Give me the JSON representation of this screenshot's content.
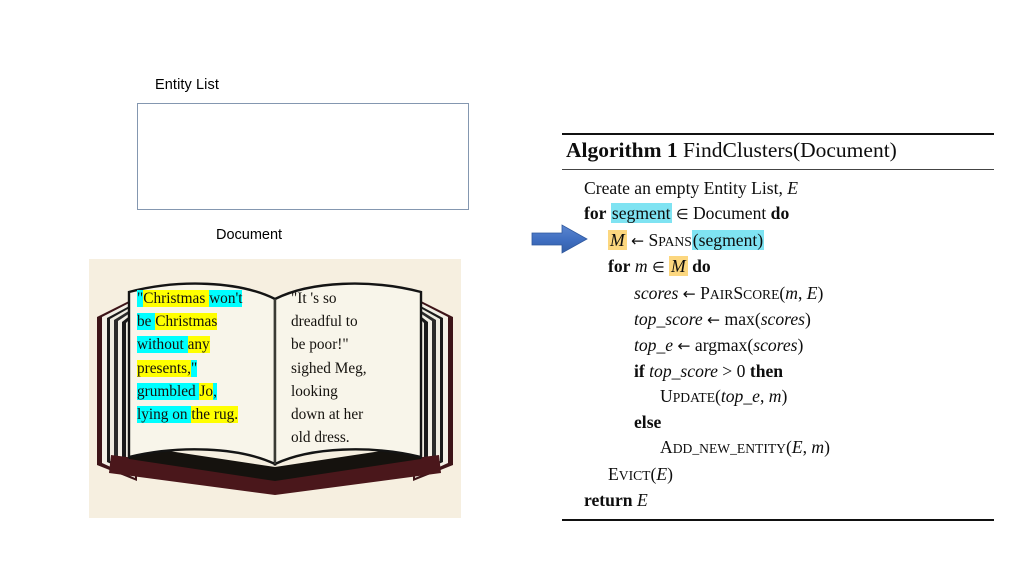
{
  "colors": {
    "page_background": "#ffffff",
    "box_border": "#8497b0",
    "arrow_blue": "#3f6ec0",
    "highlight_yellow": "#ffff00",
    "highlight_cyan": "#00ffff",
    "alg_highlight_cyan": "#7fe3f2",
    "alg_highlight_orange": "#fcd77f",
    "book_background": "#f6efe0",
    "book_cover": "#3d1418",
    "book_page": "#f7f4e8"
  },
  "entity_list": {
    "label": "Entity List",
    "box_contents": ""
  },
  "document": {
    "label": "Document",
    "left_page_lines": [
      [
        {
          "text": "\"",
          "highlight": "cyan"
        },
        {
          "text": "Christmas",
          "highlight": "yellow"
        },
        {
          "text": " ",
          "highlight": "yellow"
        },
        {
          "text": "won't",
          "highlight": "cyan"
        }
      ],
      [
        {
          "text": "be ",
          "highlight": "cyan"
        },
        {
          "text": "Christmas",
          "highlight": "yellow"
        },
        {
          "text": " ",
          "highlight": "cyan"
        }
      ],
      [
        {
          "text": "without",
          "highlight": "cyan"
        },
        {
          "text": " ",
          "highlight": "cyan"
        },
        {
          "text": "any",
          "highlight": "yellow"
        }
      ],
      [
        {
          "text": "presents,",
          "highlight": "yellow"
        },
        {
          "text": "\"",
          "highlight": "cyan"
        }
      ],
      [
        {
          "text": "grumbled ",
          "highlight": "cyan"
        },
        {
          "text": "Jo",
          "highlight": "yellow"
        },
        {
          "text": ",",
          "highlight": "cyan"
        },
        {
          "text": " ",
          "highlight": "cyan"
        }
      ],
      [
        {
          "text": "lying on ",
          "highlight": "cyan"
        },
        {
          "text": "the rug.",
          "highlight": "yellow"
        },
        {
          "text": " ",
          "highlight": "cyan"
        }
      ]
    ],
    "right_page_lines": [
      [
        {
          "text": "\"It 's so",
          "highlight": "none"
        }
      ],
      [
        {
          "text": "dreadful to",
          "highlight": "none"
        }
      ],
      [
        {
          "text": "be poor!\"",
          "highlight": "none"
        }
      ],
      [
        {
          "text": "sighed Meg,",
          "highlight": "none"
        }
      ],
      [
        {
          "text": "looking",
          "highlight": "none"
        }
      ],
      [
        {
          "text": "down at her",
          "highlight": "none"
        }
      ],
      [
        {
          "text": "old dress.",
          "highlight": "none"
        }
      ]
    ]
  },
  "pointer": {
    "icon": "right-arrow-icon",
    "points_to": "M ← Spans(segment)"
  },
  "algorithm": {
    "title_prefix": "Algorithm 1",
    "title_name": "FindClusters(Document)",
    "lines": [
      {
        "indent": 1,
        "id": "create-entity-list",
        "text": "Create an empty Entity List, E"
      },
      {
        "indent": 1,
        "id": "for-segment",
        "text": "for segment ∈ Document do"
      },
      {
        "indent": 2,
        "id": "m-spans-segment",
        "text": "M ← Spans(segment)"
      },
      {
        "indent": 2,
        "id": "for-m-in-m",
        "text": "for m ∈ M do"
      },
      {
        "indent": 3,
        "id": "scores-pairscore",
        "text": "scores ← PairScore(m, E)"
      },
      {
        "indent": 3,
        "id": "top-score-max",
        "text": "top_score ← max(scores)"
      },
      {
        "indent": 3,
        "id": "top-e-argmax",
        "text": "top_e ← argmax(scores)"
      },
      {
        "indent": 3,
        "id": "if-top-score",
        "text": "if top_score > 0 then"
      },
      {
        "indent": 4,
        "id": "update-call",
        "text": "Update(top_e, m)"
      },
      {
        "indent": 3,
        "id": "else-branch",
        "text": "else"
      },
      {
        "indent": 4,
        "id": "add-new-entity-call",
        "text": "Add_new_entity(E, m)"
      },
      {
        "indent": 2,
        "id": "evict-call",
        "text": "Evict(E)"
      },
      {
        "indent": 1,
        "id": "return-e",
        "text": "return E"
      }
    ],
    "tokens": {
      "create": "Create an empty Entity List,",
      "E": "E",
      "for": "for",
      "segment": "segment",
      "in": "∈",
      "Document": "Document",
      "do": "do",
      "M": "M",
      "gets": "←",
      "Spans_cap": "S",
      "Spans_rest": "PANS",
      "lparen": "(",
      "rparen": ")",
      "m": "m",
      "scores": "scores",
      "PairScore_p": "P",
      "PairScore_air": "AIR",
      "PairScore_s": "S",
      "PairScore_core": "CORE",
      "comma": ",",
      "top_score": "top_score",
      "max": "max",
      "top_e": "top_e",
      "argmax": "argmax",
      "if": "if",
      "gt": ">",
      "zero": "0",
      "then": "then",
      "Update_u": "U",
      "Update_rest": "PDATE",
      "else": "else",
      "Add_a": "A",
      "Add_rest": "DD_NEW_ENTITY",
      "Evict_e": "E",
      "Evict_rest": "VICT",
      "return": "return"
    }
  }
}
